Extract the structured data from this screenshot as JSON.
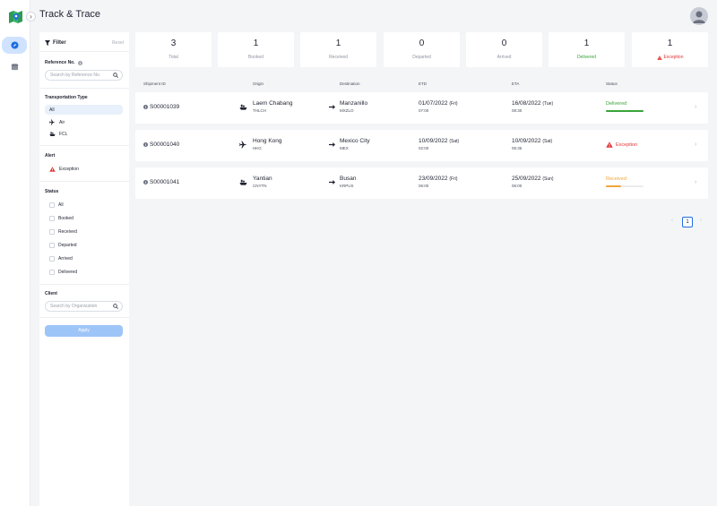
{
  "header": {
    "title": "Track & Trace"
  },
  "colors": {
    "accent": "#1d6fe0",
    "delivered": "#3aa43a",
    "exception": "#e03535",
    "received": "#f0a53b"
  },
  "filter": {
    "title": "Filter",
    "reset_label": "Reset",
    "reference": {
      "label": "Reference No.",
      "placeholder": "Search by Reference No."
    },
    "transportation": {
      "label": "Transportation Type",
      "options": [
        "All",
        "Air",
        "FCL"
      ]
    },
    "alert": {
      "label": "Alert",
      "options": [
        "Exception"
      ]
    },
    "status": {
      "label": "Status",
      "options": [
        "All",
        "Booked",
        "Received",
        "Departed",
        "Arrived",
        "Delivered"
      ]
    },
    "client": {
      "label": "Client",
      "placeholder": "Search by Organization"
    },
    "apply_label": "Apply"
  },
  "stats": [
    {
      "value": "3",
      "label": "Total"
    },
    {
      "value": "1",
      "label": "Booked"
    },
    {
      "value": "1",
      "label": "Received"
    },
    {
      "value": "0",
      "label": "Departed"
    },
    {
      "value": "0",
      "label": "Arrived"
    },
    {
      "value": "1",
      "label": "Delivered"
    },
    {
      "value": "1",
      "label": "Exception"
    }
  ],
  "table": {
    "headers": [
      "Shipment ID",
      "Origin",
      "Destination",
      "ETD",
      "ETA",
      "Status"
    ],
    "rows": [
      {
        "id": "S00001039",
        "mode": "ship-icon",
        "origin": "Laem Chabang",
        "origin_code": "THLCH",
        "dest": "Manzanillo",
        "dest_code": "MXZLO",
        "etd_date": "01/07/2022",
        "etd_day": "(Fri)",
        "etd_time": "07:00",
        "eta_date": "16/08/2022",
        "eta_day": "(Tue)",
        "eta_time": "08:30",
        "status": "Delivered",
        "progress": 1.0
      },
      {
        "id": "S00001040",
        "mode": "plane-icon",
        "origin": "Hong Kong",
        "origin_code": "HKG",
        "dest": "Mexico City",
        "dest_code": "MEX",
        "etd_date": "10/09/2022",
        "etd_day": "(Sat)",
        "etd_time": "02:00",
        "eta_date": "10/09/2022",
        "eta_day": "(Sat)",
        "eta_time": "05:35",
        "status": "Exception"
      },
      {
        "id": "S00001041",
        "mode": "ship-icon",
        "origin": "Yantian",
        "origin_code": "CNYTN",
        "dest": "Busan",
        "dest_code": "KRPUS",
        "etd_date": "23/09/2022",
        "etd_day": "(Fri)",
        "etd_time": "06:00",
        "eta_date": "25/09/2022",
        "eta_day": "(Sun)",
        "eta_time": "06:00",
        "status": "Received",
        "progress": 0.4
      }
    ]
  },
  "pagination": {
    "prev": "‹",
    "current": "1",
    "next": "›"
  }
}
